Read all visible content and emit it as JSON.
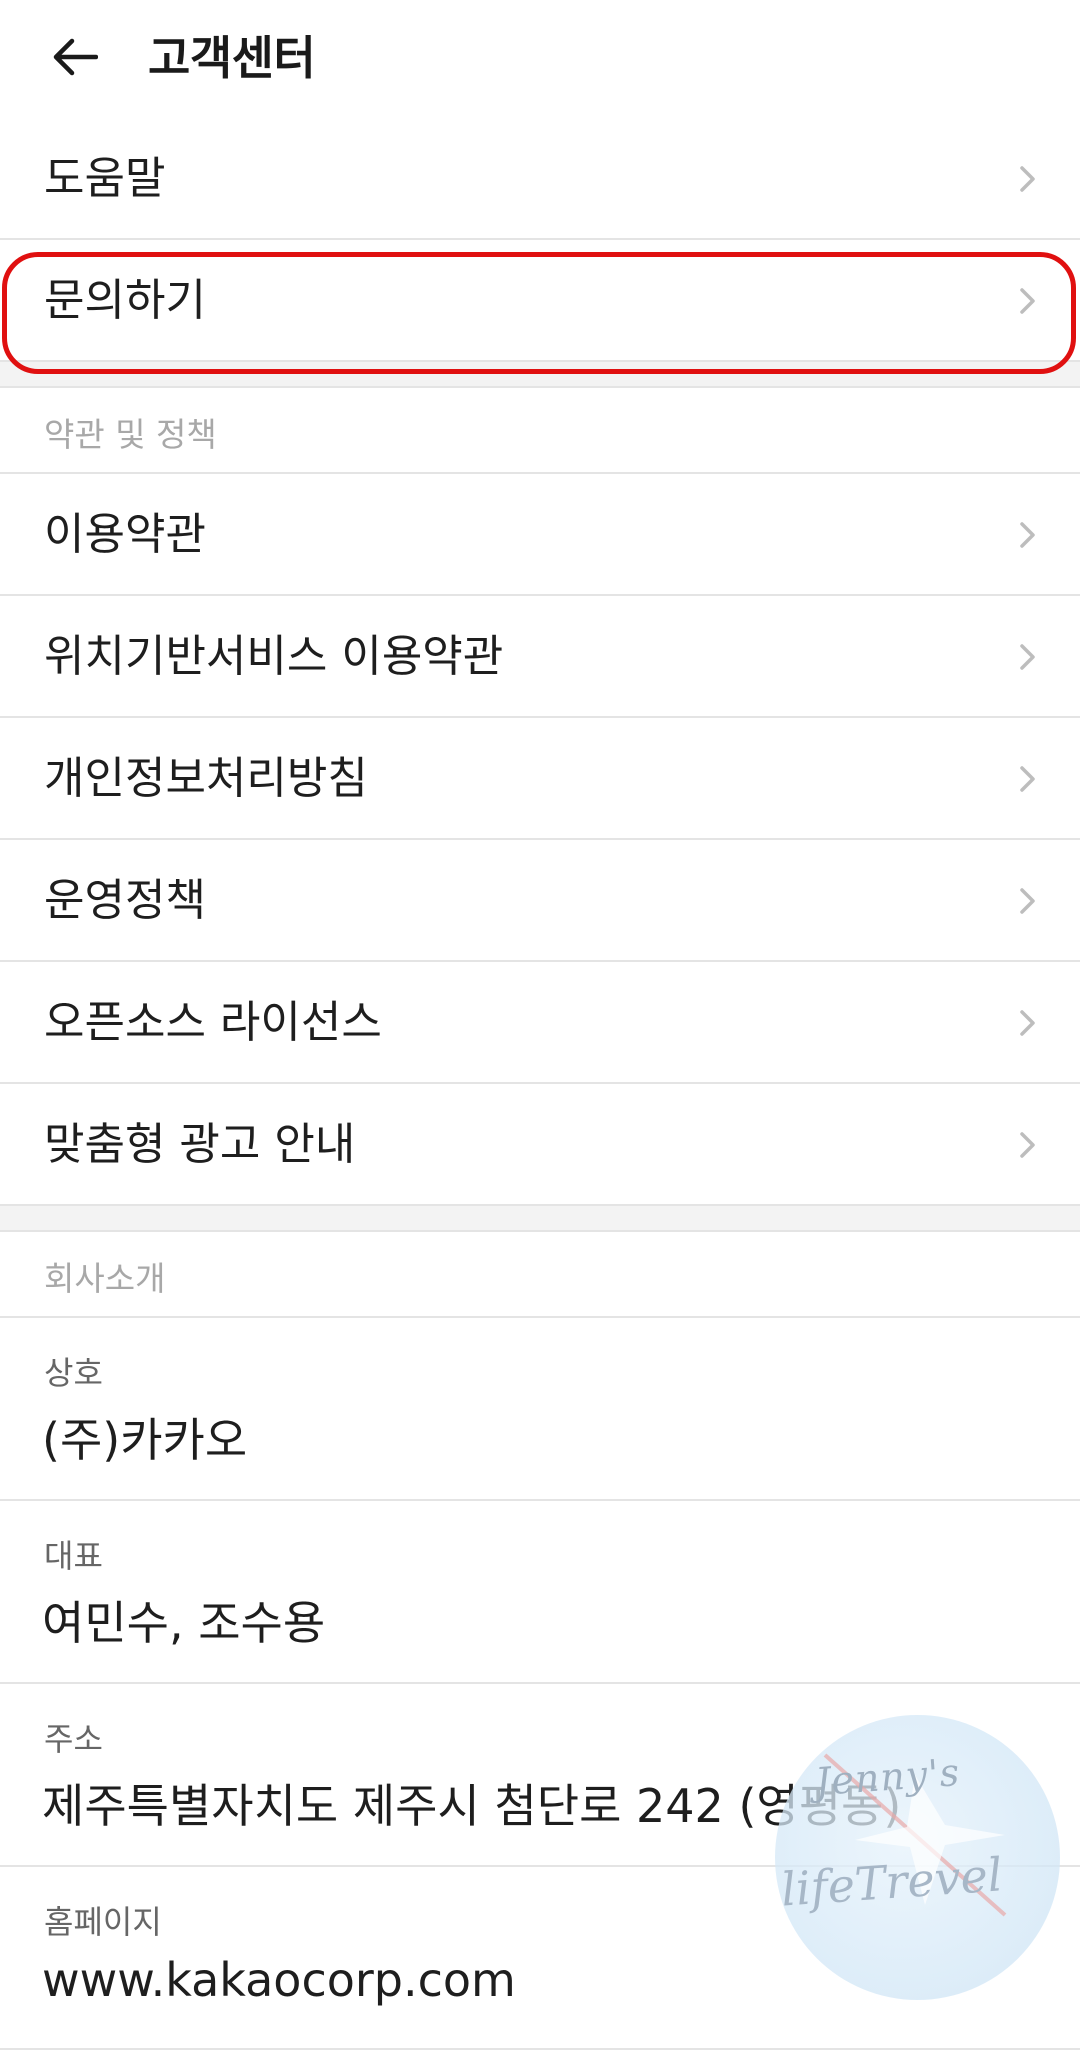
{
  "header": {
    "title": "고객센터",
    "back_icon": "arrow-left-icon"
  },
  "support_items": [
    {
      "label": "도움말"
    },
    {
      "label": "문의하기"
    }
  ],
  "policy_section": {
    "title": "약관 및 정책",
    "items": [
      {
        "label": "이용약관"
      },
      {
        "label": "위치기반서비스 이용약관"
      },
      {
        "label": "개인정보처리방침"
      },
      {
        "label": "운영정책"
      },
      {
        "label": "오픈소스 라이선스"
      },
      {
        "label": "맞춤형 광고 안내"
      }
    ]
  },
  "company_section": {
    "title": "회사소개",
    "items": [
      {
        "label": "상호",
        "value": "(주)카카오"
      },
      {
        "label": "대표",
        "value": "여민수, 조수용"
      },
      {
        "label": "주소",
        "value": "제주특별자치도 제주시 첨단로 242 (영평동)"
      },
      {
        "label": "홈페이지",
        "value": "www.kakaocorp.com"
      }
    ]
  },
  "highlight_color": "#e01010",
  "watermark": {
    "line1": "Jenny's",
    "line2": "lifeTrevel"
  }
}
